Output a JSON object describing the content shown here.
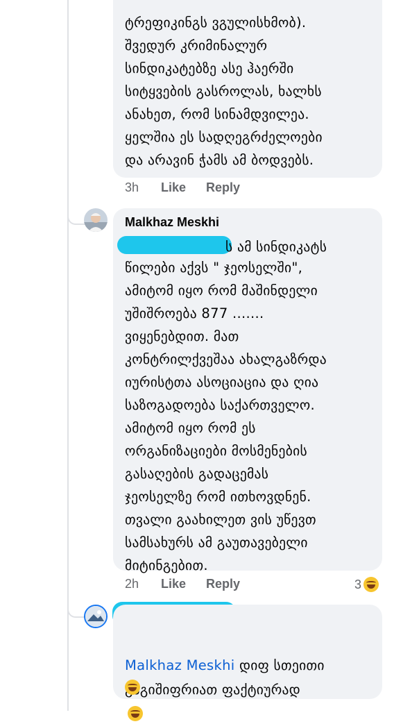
{
  "comment1": {
    "text": "ტრეფიკინგს ვგულისხმობ).\nშვედურ კრიმინალურ\nსინდიკატებზე ასე ჰაერში\nსიტყვების გასროლას, ხალხს\nანახეთ, რომ სინამდვილეა.\nყელშია ეს სადღეგრძელოები\nდა არავინ ჭამს ამ ბოდვებს.",
    "time": "3h",
    "like_label": "Like",
    "reply_label": "Reply"
  },
  "comment2": {
    "author": "Malkhaz Meskhi",
    "first_line_tail": "ს ამ სინდიკატს",
    "text": "წილები აქვს \" ჯეოსელში\",\nამიტომ იყო რომ მაშინდელი\nუშიშროება 877 .......\nვიყენებდით. მათ\nკონტრილქვეშაა ახალგაზრდა\nიურისტთა ასოციაცია და ღია\nსაზოგადოება საქართველო.\nამიტომ იყო რომ ეს\nორგანიზაციები მოსმენების\nგასაღების გადაცემას\nჯეოსელზე რომ ითხოვდნენ.\nთვალი გაახილეთ ვის უწევთ\nსამსახურს ამ გაუთავებელი\nმიტინგებით.",
    "time": "2h",
    "like_label": "Like",
    "reply_label": "Reply",
    "reaction_count": "3",
    "reaction_icon": "laughing-emoji-icon"
  },
  "reply3": {
    "mention": "Malkhaz Meskhi",
    "text_line1": " დიფ სთეითი",
    "text_line2": "გაგიშიფრიათ ფაქტიურად"
  },
  "colors": {
    "bubble": "#f0f2f5",
    "meta": "#65676b",
    "mention": "#0b5fd3",
    "redaction": "#1ec6ec"
  }
}
